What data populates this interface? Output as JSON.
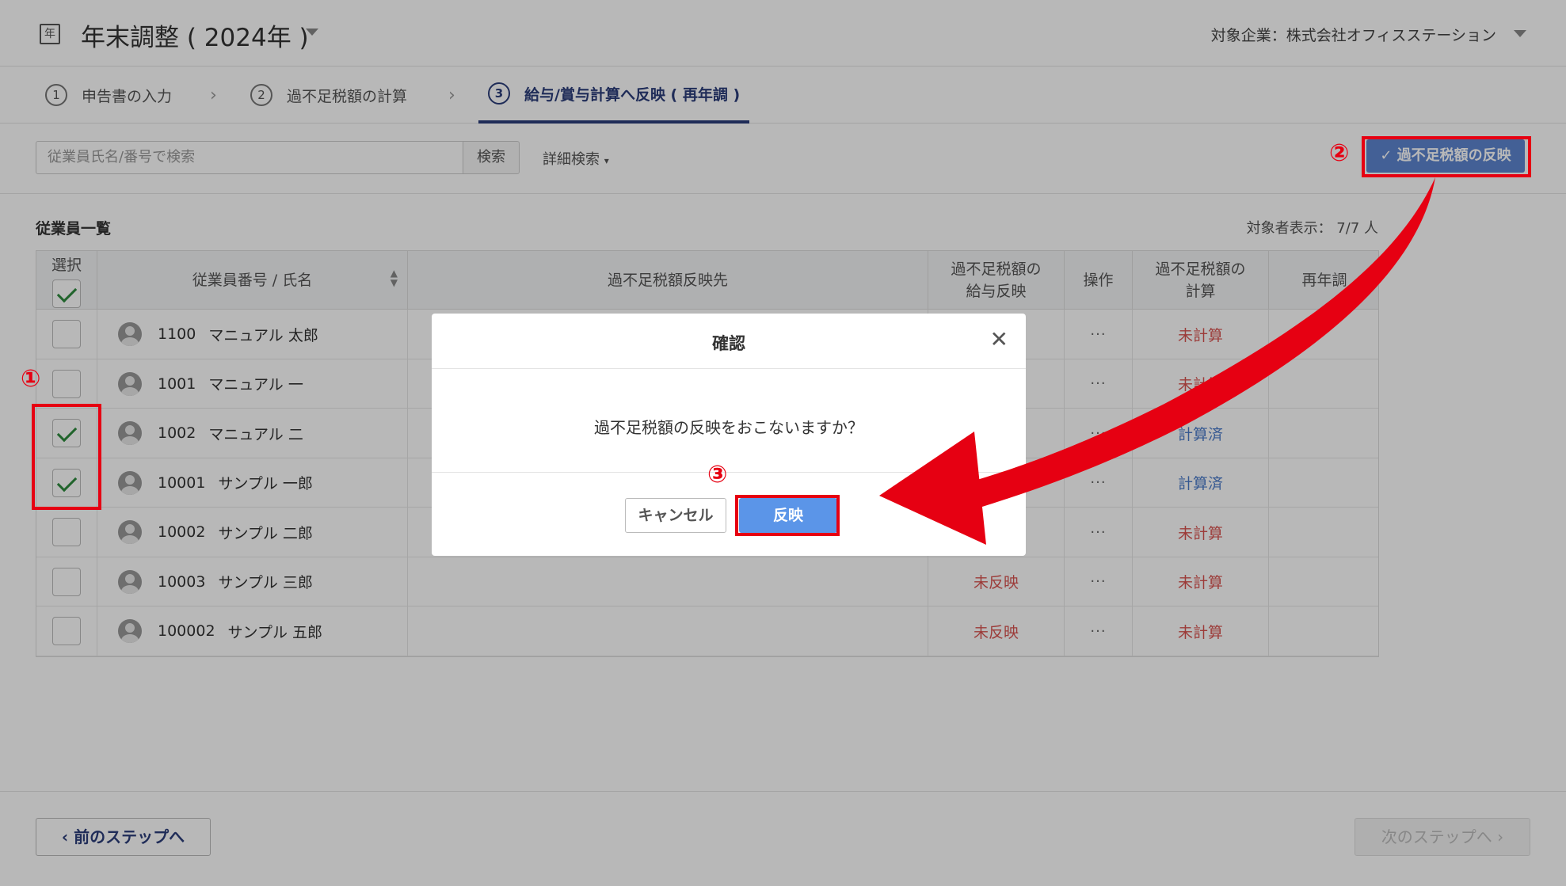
{
  "header": {
    "app_icon": "年",
    "title": "年末調整 ( 2024年 )",
    "company": "対象企業：株式会社オフィスステーション"
  },
  "steps": [
    {
      "num": "1",
      "label": "申告書の入力"
    },
    {
      "num": "2",
      "label": "過不足税額の計算"
    },
    {
      "num": "3",
      "label": "給与/賞与計算へ反映 ( 再年調 )"
    }
  ],
  "toolbar": {
    "search_placeholder": "従業員氏名/番号で検索",
    "search_button": "検索",
    "advanced_search": "詳細検索",
    "reflect_button": "過不足税額の反映"
  },
  "list": {
    "title": "従業員一覧",
    "count": "対象者表示： 7/7 人"
  },
  "table": {
    "headers": {
      "select": "選択",
      "employee": "従業員番号 / 氏名",
      "target": "過不足税額反映先",
      "salary_reflect_1": "過不足税額の",
      "salary_reflect_2": "給与反映",
      "ops": "操作",
      "calc_1": "過不足税額の",
      "calc_2": "計算",
      "rere": "再年調"
    },
    "rows": [
      {
        "no": "1100",
        "name": "マニュアル 太郎",
        "checked": false,
        "reflect": "",
        "ops": "···",
        "calc": "未計算",
        "calc_status": "red"
      },
      {
        "no": "1001",
        "name": "マニュアル 一",
        "checked": false,
        "reflect": "",
        "ops": "···",
        "calc": "未計算",
        "calc_status": "red"
      },
      {
        "no": "1002",
        "name": "マニュアル 二",
        "checked": true,
        "reflect": "",
        "ops": "···",
        "calc": "計算済",
        "calc_status": "blue"
      },
      {
        "no": "10001",
        "name": "サンプル 一郎",
        "checked": true,
        "reflect": "",
        "ops": "···",
        "calc": "計算済",
        "calc_status": "blue"
      },
      {
        "no": "10002",
        "name": "サンプル 二郎",
        "checked": false,
        "reflect": "",
        "ops": "···",
        "calc": "未計算",
        "calc_status": "red"
      },
      {
        "no": "10003",
        "name": "サンプル 三郎",
        "checked": false,
        "reflect": "未反映",
        "ops": "···",
        "calc": "未計算",
        "calc_status": "red"
      },
      {
        "no": "100002",
        "name": "サンプル 五郎",
        "checked": false,
        "reflect": "未反映",
        "ops": "···",
        "calc": "未計算",
        "calc_status": "red"
      }
    ]
  },
  "footer": {
    "prev": "前のステップへ",
    "next": "次のステップへ"
  },
  "modal": {
    "title": "確認",
    "message": "過不足税額の反映をおこないますか？",
    "cancel": "キャンセル",
    "confirm": "反映"
  },
  "annotations": {
    "one": "①",
    "two": "②",
    "three": "③",
    "color": "#e60012"
  },
  "colors": {
    "primary": "#2c3e7a",
    "button_blue": "#5b95e8",
    "status_red": "#d9534f",
    "status_blue": "#4a7ac9"
  }
}
